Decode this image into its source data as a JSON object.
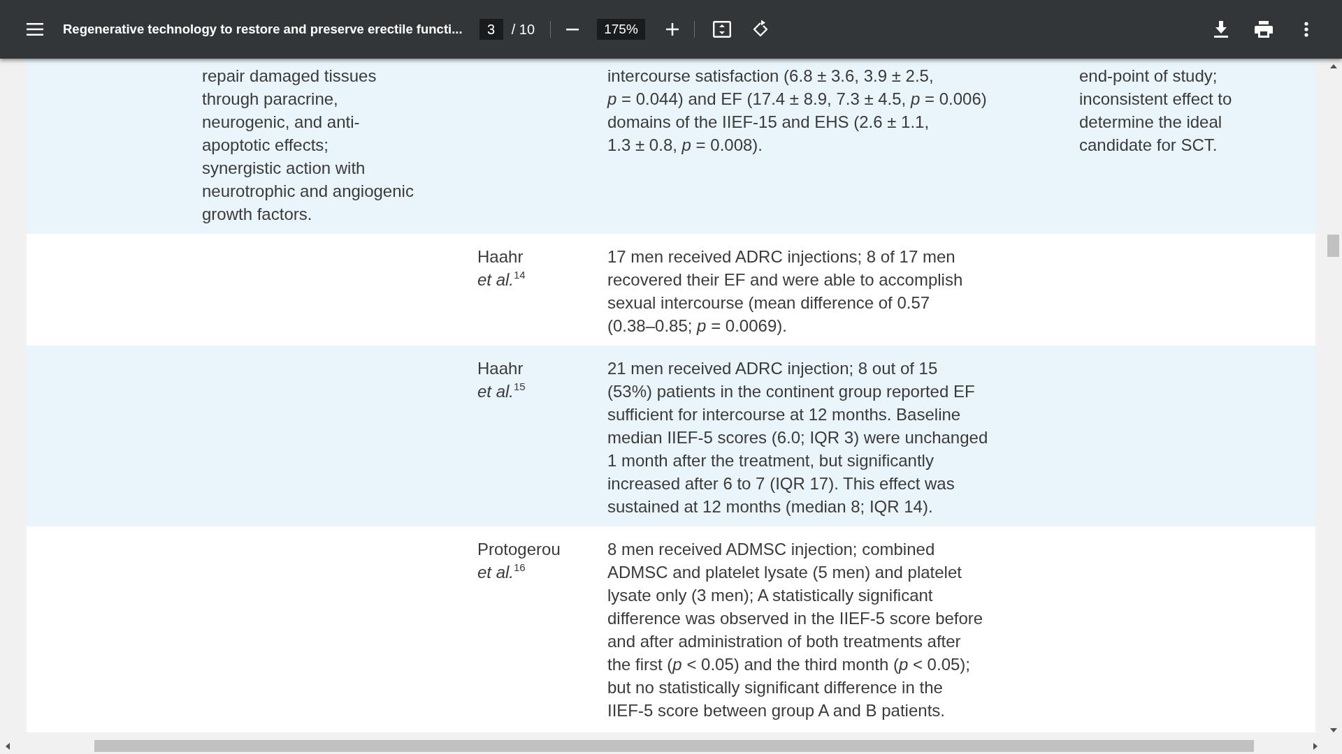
{
  "toolbar": {
    "title": "Regenerative technology to restore and preserve erectile functi...",
    "page": "3",
    "page_total": "/ 10",
    "zoom": "175%"
  },
  "table": {
    "rows": [
      {
        "shaded": true,
        "column_1": "repair damaged tissues\nthrough paracrine,\nneurogenic, and anti-\napoptotic effects;\nsynergistic action with\nneurotrophic and angiogenic\ngrowth factors.",
        "column_3": "intercourse satisfaction (6.8 ± 3.6, 3.9 ± 2.5,\n*p* = 0.044) and EF (17.4 ± 8.9, 7.3 ± 4.5, *p* = 0.006)\ndomains of the IIEF-15 and EHS (2.6 ± 1.1,\n1.3 ± 0.8, *p* = 0.008).",
        "column_4": "end-point of study;\ninconsistent effect to\ndetermine the ideal\ncandidate for SCT."
      },
      {
        "shaded": false,
        "column_2": "Haahr\n*et al.*$^{14}$",
        "column_3": "17 men received ADRC injections; 8 of 17 men\nrecovered their EF and were able to accomplish\nsexual intercourse (mean difference of 0.57\n(0.38–0.85; *p* = 0.0069)."
      },
      {
        "shaded": true,
        "column_2": "Haahr\n*et al.*$^{15}$",
        "column_3": "21 men received ADRC injection; 8 out of 15\n(53%) patients in the continent group reported EF\nsufficient for intercourse at 12 months. Baseline\nmedian IIEF-5 scores (6.0; IQR 3) were unchanged\n1 month after the treatment, but significantly\nincreased after 6 to 7 (IQR 17). This effect was\nsustained at 12 months (median 8; IQR 14)."
      },
      {
        "shaded": false,
        "column_2": "Protogerou\n*et al.*$^{16}$",
        "column_3": "8 men received ADMSC injection; combined\nADMSC and platelet lysate (5 men) and platelet\nlysate only (3 men); A statistically significant\ndifference was observed in the IIEF-5 score before\nand after administration of both treatments after\nthe first (*p* < 0.05) and the third month (*p* < 0.05);\nbut no statistically significant difference in the\nIIEF-5 score between group A and B patients."
      }
    ]
  }
}
